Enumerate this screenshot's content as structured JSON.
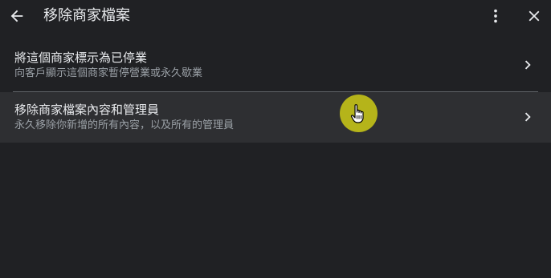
{
  "header": {
    "back_icon": "arrow-left-icon",
    "title": "移除商家檔案",
    "more_icon": "more-vert-icon",
    "close_icon": "close-icon"
  },
  "options": [
    {
      "title": "將這個商家標示為已停業",
      "subtitle": "向客戶顯示這個商家暫停營業或永久歇業",
      "icon": "chevron-right-icon"
    },
    {
      "title": "移除商家檔案內容和管理員",
      "subtitle": "永久移除你新增的所有內容，以及所有的管理員",
      "icon": "chevron-right-icon",
      "hovered": true
    }
  ],
  "cursor": {
    "icon": "hand-pointer-icon",
    "highlight_color": "#b5b41a"
  },
  "colors": {
    "background": "#202124",
    "hover_row": "#2e2f32",
    "text_primary": "#e8eaed",
    "text_secondary": "#9aa0a6",
    "divider": "#5f6368"
  }
}
